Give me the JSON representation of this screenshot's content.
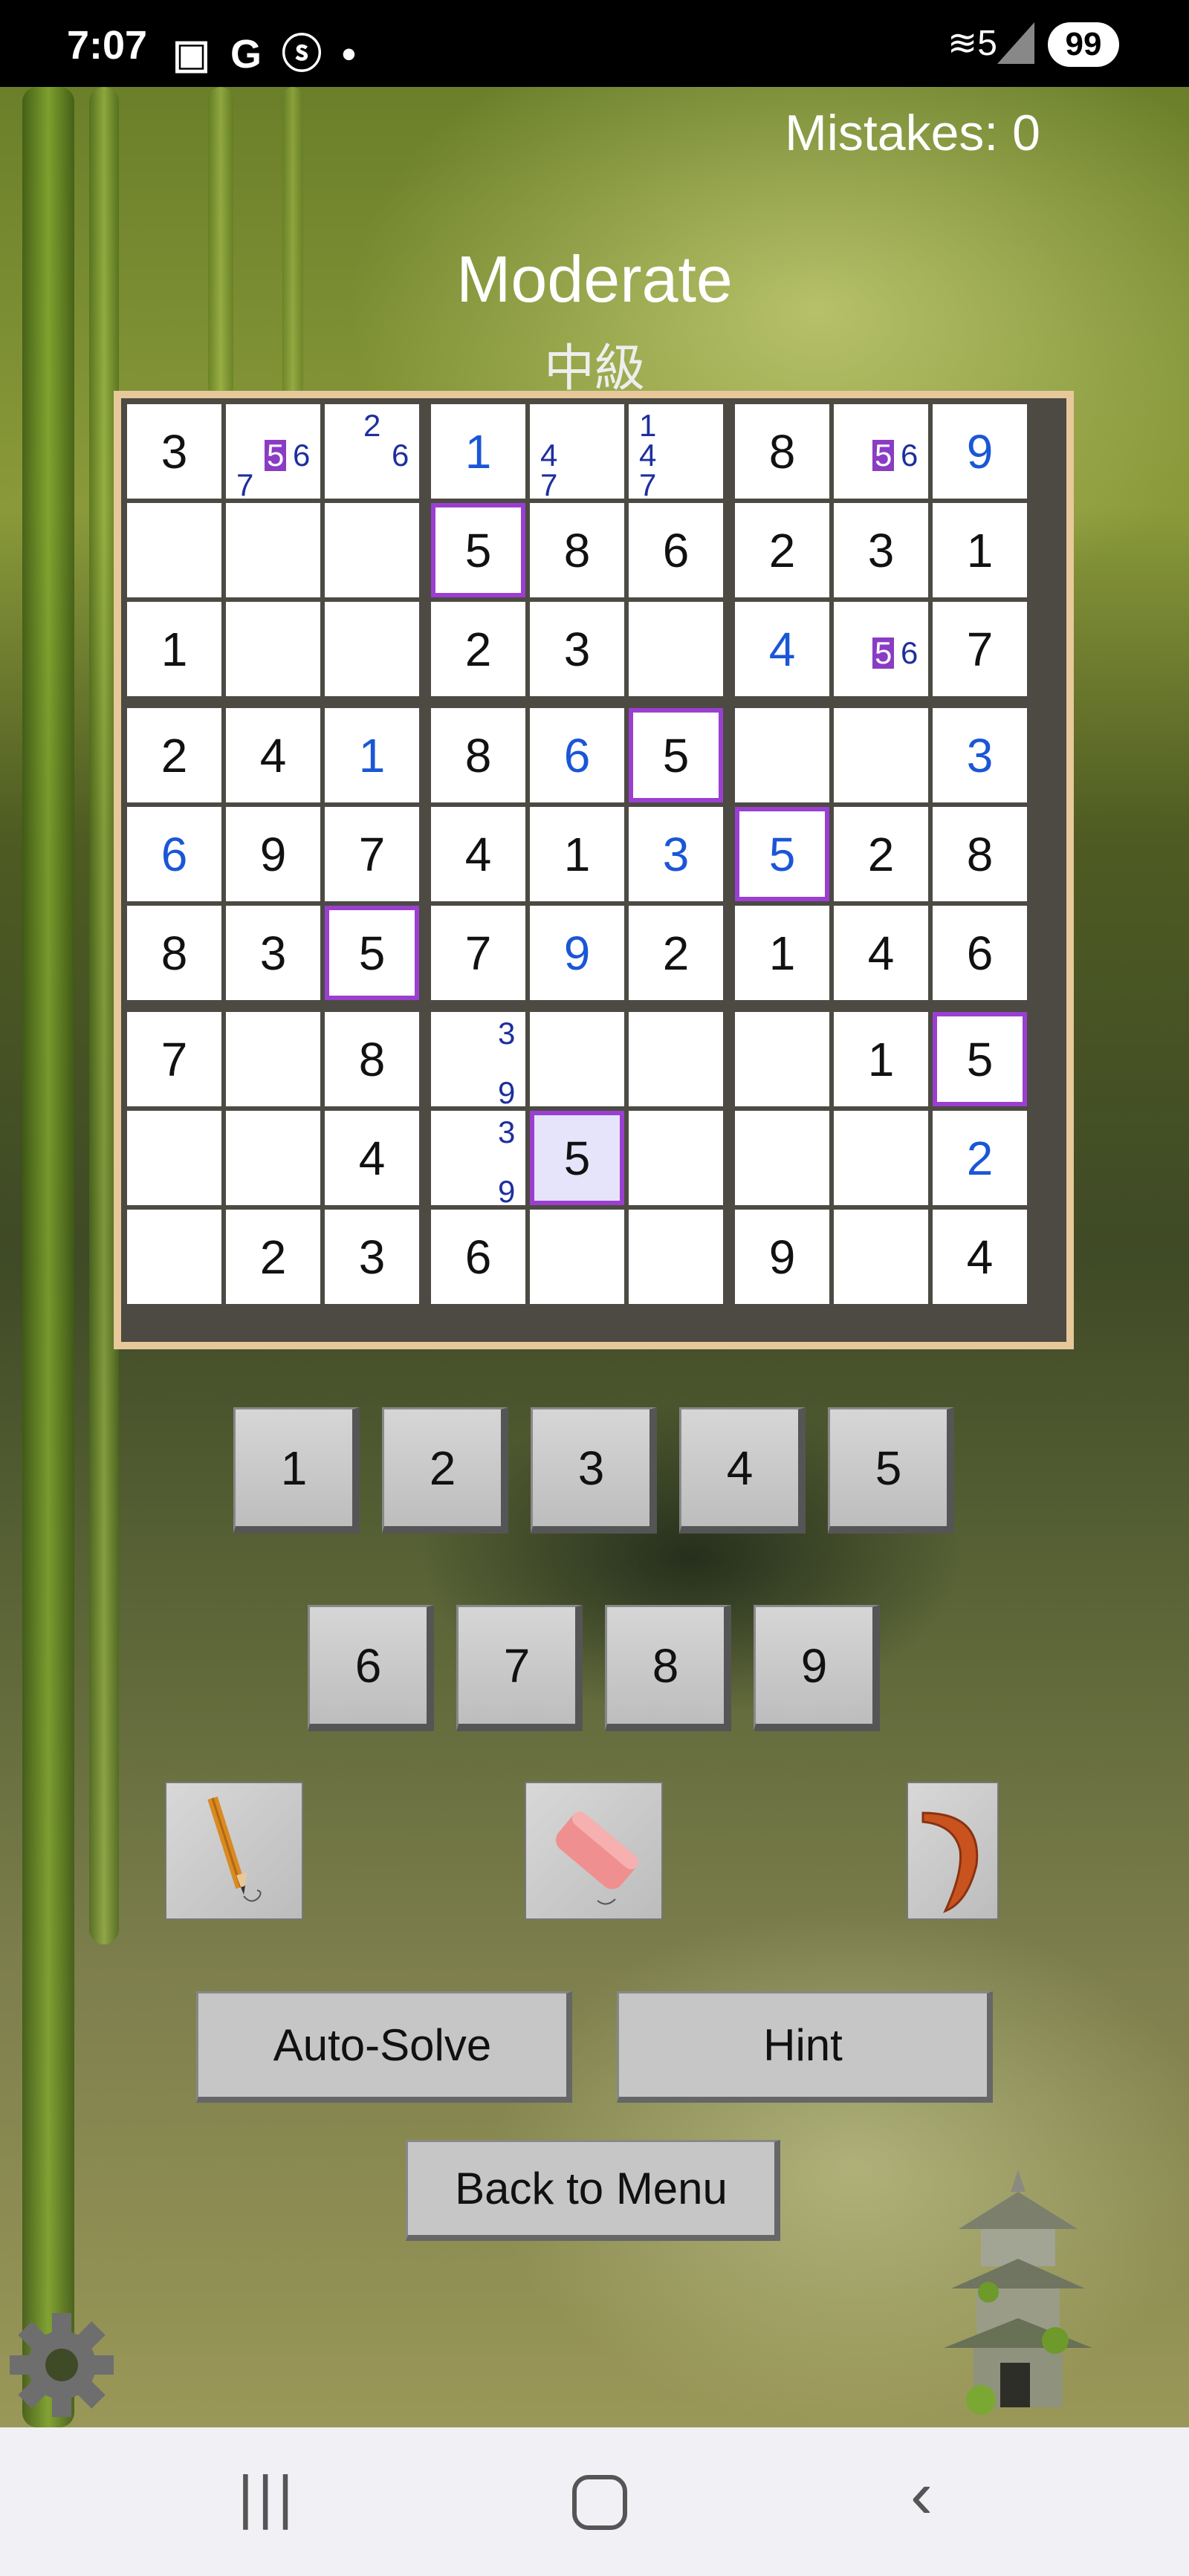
{
  "status": {
    "time": "7:07",
    "icons": "▣ G ⓢ •",
    "battery": "99",
    "wifi": "≋5"
  },
  "game": {
    "mistakes": "Mistakes: 0",
    "difficulty": "Moderate",
    "difficulty_jp": "中級"
  },
  "board": {
    "cells": [
      [
        {
          "v": "3"
        },
        {
          "n": [
            "5",
            "6",
            "7"
          ],
          "hi": "5"
        },
        {
          "n": [
            "2",
            "6"
          ]
        },
        {
          "v": "1",
          "e": 1
        },
        {
          "n": [
            "4",
            "7"
          ]
        },
        {
          "n": [
            "1",
            "4",
            "7"
          ]
        },
        {
          "v": "8"
        },
        {
          "n": [
            "5",
            "6"
          ],
          "hi": "5"
        },
        {
          "v": "9",
          "e": 1
        }
      ],
      [
        {},
        {},
        {},
        {
          "v": "5",
          "sel": 1
        },
        {
          "v": "8"
        },
        {
          "v": "6"
        },
        {
          "v": "2"
        },
        {
          "v": "3"
        },
        {
          "v": "1"
        }
      ],
      [
        {
          "v": "1"
        },
        {},
        {},
        {
          "v": "2"
        },
        {
          "v": "3"
        },
        {},
        {
          "v": "4",
          "e": 1
        },
        {
          "n": [
            "5",
            "6"
          ],
          "hi": "5"
        },
        {
          "v": "7"
        }
      ],
      [
        {
          "v": "2"
        },
        {
          "v": "4"
        },
        {
          "v": "1",
          "e": 1
        },
        {
          "v": "8"
        },
        {
          "v": "6",
          "e": 1
        },
        {
          "v": "5",
          "sel": 1
        },
        {},
        {},
        {
          "v": "3",
          "e": 1
        }
      ],
      [
        {
          "v": "6",
          "e": 1
        },
        {
          "v": "9"
        },
        {
          "v": "7"
        },
        {
          "v": "4"
        },
        {
          "v": "1"
        },
        {
          "v": "3",
          "e": 1
        },
        {
          "v": "5",
          "e": 1,
          "sel": 1
        },
        {
          "v": "2"
        },
        {
          "v": "8"
        }
      ],
      [
        {
          "v": "8"
        },
        {
          "v": "3"
        },
        {
          "v": "5",
          "sel": 1
        },
        {
          "v": "7"
        },
        {
          "v": "9",
          "e": 1
        },
        {
          "v": "2"
        },
        {
          "v": "1"
        },
        {
          "v": "4"
        },
        {
          "v": "6"
        }
      ],
      [
        {
          "v": "7"
        },
        {},
        {
          "v": "8"
        },
        {
          "n": [
            "3",
            "9"
          ]
        },
        {},
        {},
        {},
        {
          "v": "1"
        },
        {
          "v": "5",
          "sel": 1
        }
      ],
      [
        {},
        {},
        {
          "v": "4"
        },
        {
          "n": [
            "3",
            "9"
          ]
        },
        {
          "v": "5",
          "sel": 1,
          "hl": 1
        },
        {},
        {},
        {},
        {
          "v": "2",
          "e": 1
        }
      ],
      [
        {},
        {
          "v": "2"
        },
        {
          "v": "3"
        },
        {
          "v": "6"
        },
        {},
        {},
        {
          "v": "9"
        },
        {},
        {
          "v": "4"
        }
      ]
    ]
  },
  "keypad": {
    "row1": [
      "1",
      "2",
      "3",
      "4",
      "5"
    ],
    "row2": [
      "6",
      "7",
      "8",
      "9"
    ]
  },
  "tools": {
    "pencil": "pencil-icon",
    "eraser": "eraser-icon",
    "undo": "boomerang-icon"
  },
  "actions": {
    "auto_solve": "Auto-Solve",
    "hint": "Hint",
    "back": "Back to Menu"
  },
  "colors": {
    "entered": "#1a56d6",
    "note": "#1d2f9e",
    "selection": "#9b3fd0",
    "board_frame": "#e7c89b"
  }
}
